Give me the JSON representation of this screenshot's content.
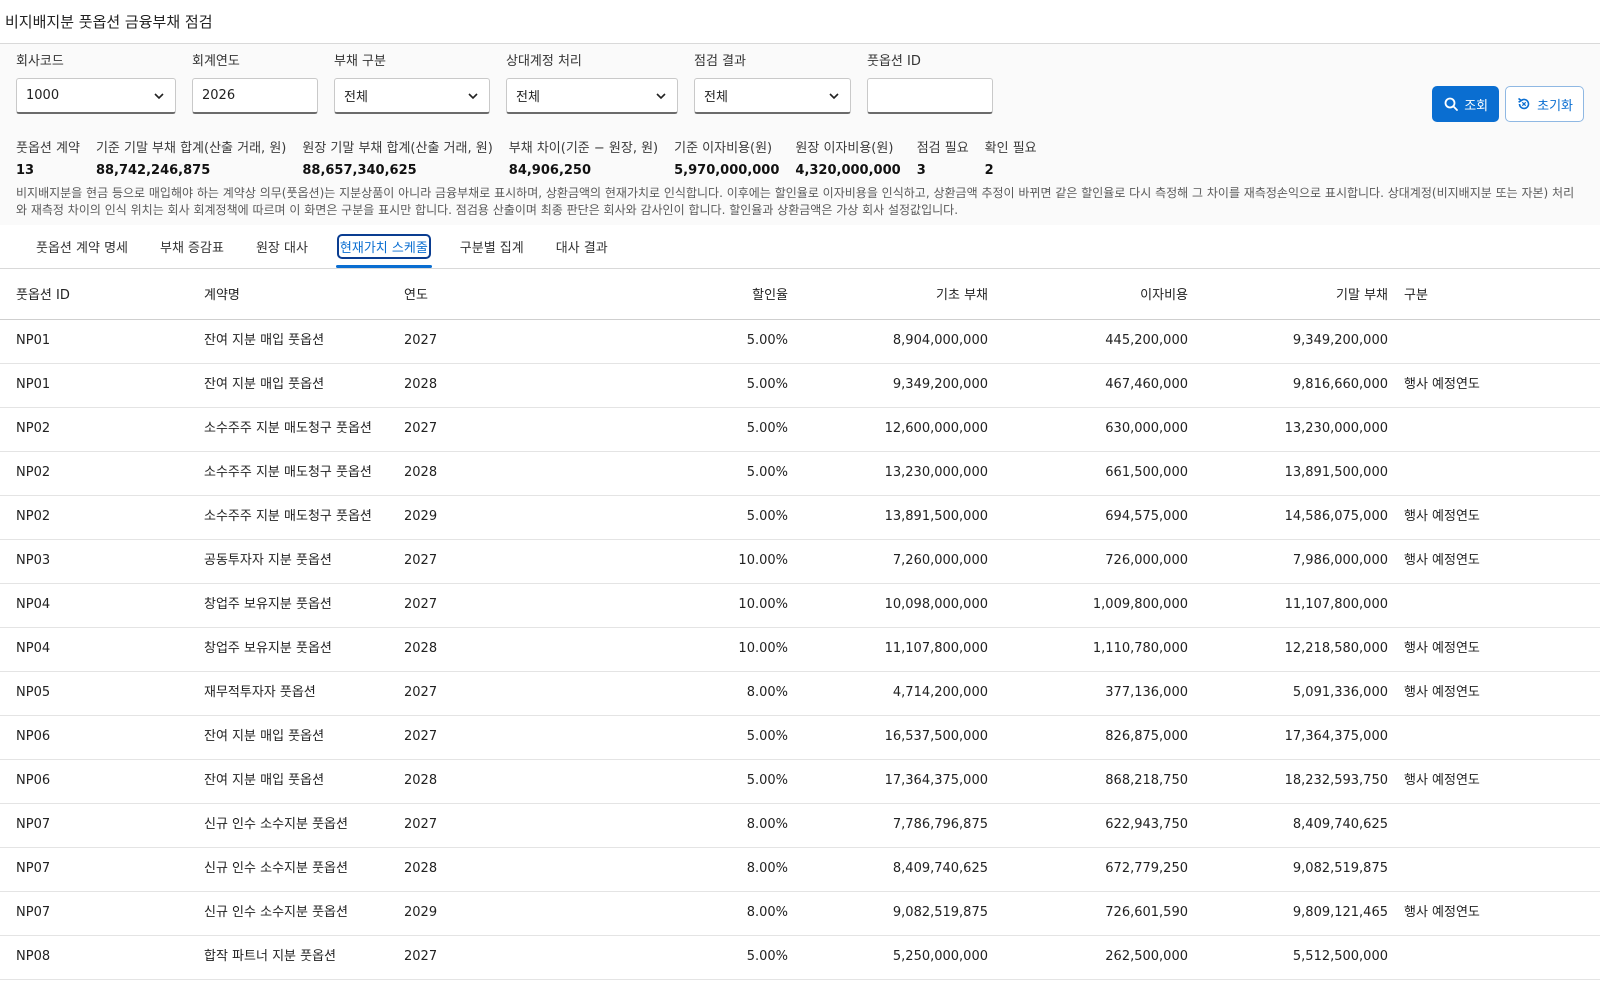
{
  "app": {
    "title": "비지배지분 풋옵션 금융부채 점검"
  },
  "filters": {
    "company_code": {
      "label": "회사코드",
      "value": "1000"
    },
    "fiscal_year": {
      "label": "회계연도",
      "value": "2026"
    },
    "liability_type": {
      "label": "부채 구분",
      "value": "전체"
    },
    "counter_account": {
      "label": "상대계정 처리",
      "value": "전체"
    },
    "check_result": {
      "label": "점검 결과",
      "value": "전체"
    },
    "option_id": {
      "label": "풋옵션 ID",
      "value": ""
    }
  },
  "actions": {
    "search_label": "조회",
    "reset_label": "초기화"
  },
  "summary": [
    {
      "label": "풋옵션 계약",
      "value": "13"
    },
    {
      "label": "기준 기말 부채 합계(산출 거래, 원)",
      "value": "88,742,246,875"
    },
    {
      "label": "원장 기말 부채 합계(산출 거래, 원)",
      "value": "88,657,340,625"
    },
    {
      "label": "부채 차이(기준 − 원장, 원)",
      "value": "84,906,250"
    },
    {
      "label": "기준 이자비용(원)",
      "value": "5,970,000,000"
    },
    {
      "label": "원장 이자비용(원)",
      "value": "4,320,000,000"
    },
    {
      "label": "점검 필요",
      "value": "3"
    },
    {
      "label": "확인 필요",
      "value": "2"
    }
  ],
  "notice": "비지배지분을 현금 등으로 매입해야 하는 계약상 의무(풋옵션)는 지분상품이 아니라 금융부채로 표시하며, 상환금액의 현재가치로 인식합니다. 이후에는 할인율로 이자비용을 인식하고, 상환금액 추정이 바뀌면 같은 할인율로 다시 측정해 그 차이를 재측정손익으로 표시합니다. 상대계정(비지배지분 또는 자본) 처리와 재측정 차이의 인식 위치는 회사 회계정책에 따르며 이 화면은 구분을 표시만 합니다. 점검용 산출이며 최종 판단은 회사와 감사인이 합니다. 할인율과 상환금액은 가상 회사 설정값입니다.",
  "tabs": [
    {
      "label": "풋옵션 계약 명세"
    },
    {
      "label": "부채 증감표"
    },
    {
      "label": "원장 대사"
    },
    {
      "label": "현재가치 스케줄"
    },
    {
      "label": "구분별 집계"
    },
    {
      "label": "대사 결과"
    }
  ],
  "active_tab_index": 3,
  "table": {
    "columns": [
      "풋옵션 ID",
      "계약명",
      "연도",
      "할인율",
      "기초 부채",
      "이자비용",
      "기말 부채",
      "구분"
    ],
    "rows": [
      [
        "NP01",
        "잔여 지분 매입 풋옵션",
        "2027",
        "5.00%",
        "8,904,000,000",
        "445,200,000",
        "9,349,200,000",
        ""
      ],
      [
        "NP01",
        "잔여 지분 매입 풋옵션",
        "2028",
        "5.00%",
        "9,349,200,000",
        "467,460,000",
        "9,816,660,000",
        "행사 예정연도"
      ],
      [
        "NP02",
        "소수주주 지분 매도청구 풋옵션",
        "2027",
        "5.00%",
        "12,600,000,000",
        "630,000,000",
        "13,230,000,000",
        ""
      ],
      [
        "NP02",
        "소수주주 지분 매도청구 풋옵션",
        "2028",
        "5.00%",
        "13,230,000,000",
        "661,500,000",
        "13,891,500,000",
        ""
      ],
      [
        "NP02",
        "소수주주 지분 매도청구 풋옵션",
        "2029",
        "5.00%",
        "13,891,500,000",
        "694,575,000",
        "14,586,075,000",
        "행사 예정연도"
      ],
      [
        "NP03",
        "공동투자자 지분 풋옵션",
        "2027",
        "10.00%",
        "7,260,000,000",
        "726,000,000",
        "7,986,000,000",
        "행사 예정연도"
      ],
      [
        "NP04",
        "창업주 보유지분 풋옵션",
        "2027",
        "10.00%",
        "10,098,000,000",
        "1,009,800,000",
        "11,107,800,000",
        ""
      ],
      [
        "NP04",
        "창업주 보유지분 풋옵션",
        "2028",
        "10.00%",
        "11,107,800,000",
        "1,110,780,000",
        "12,218,580,000",
        "행사 예정연도"
      ],
      [
        "NP05",
        "재무적투자자 풋옵션",
        "2027",
        "8.00%",
        "4,714,200,000",
        "377,136,000",
        "5,091,336,000",
        "행사 예정연도"
      ],
      [
        "NP06",
        "잔여 지분 매입 풋옵션",
        "2027",
        "5.00%",
        "16,537,500,000",
        "826,875,000",
        "17,364,375,000",
        ""
      ],
      [
        "NP06",
        "잔여 지분 매입 풋옵션",
        "2028",
        "5.00%",
        "17,364,375,000",
        "868,218,750",
        "18,232,593,750",
        "행사 예정연도"
      ],
      [
        "NP07",
        "신규 인수 소수지분 풋옵션",
        "2027",
        "8.00%",
        "7,786,796,875",
        "622,943,750",
        "8,409,740,625",
        ""
      ],
      [
        "NP07",
        "신규 인수 소수지분 풋옵션",
        "2028",
        "8.00%",
        "8,409,740,625",
        "672,779,250",
        "9,082,519,875",
        ""
      ],
      [
        "NP07",
        "신규 인수 소수지분 풋옵션",
        "2029",
        "8.00%",
        "9,082,519,875",
        "726,601,590",
        "9,809,121,465",
        "행사 예정연도"
      ],
      [
        "NP08",
        "합작 파트너 지분 풋옵션",
        "2027",
        "5.00%",
        "5,250,000,000",
        "262,500,000",
        "5,512,500,000",
        ""
      ]
    ]
  }
}
